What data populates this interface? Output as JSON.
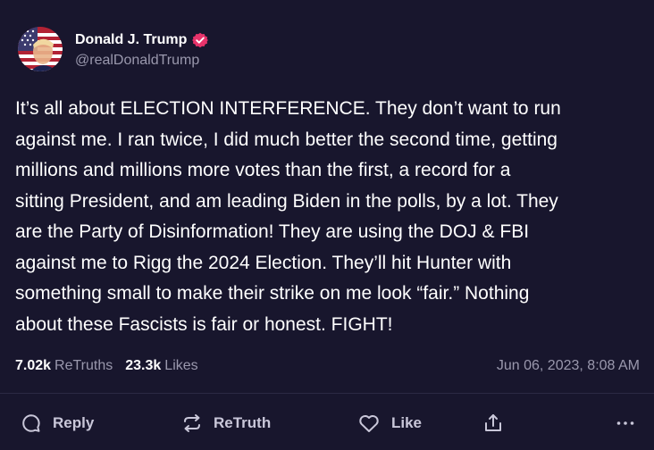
{
  "author": {
    "display_name": "Donald J. Trump",
    "handle": "@realDonaldTrump",
    "verified_icon": "verified-badge-icon",
    "badge_color": "#e8336b"
  },
  "post": {
    "text": "It’s all about ELECTION INTERFERENCE. They don’t want to run\nagainst me. I ran twice, I did much better the second time, getting\nmillions and millions more votes than the first, a record for a\nsitting President, and am leading Biden in the polls, by a lot. They\nare the Party of Disinformation! They are using the DOJ & FBI\nagainst me to Rigg the 2024 Election. They’ll hit Hunter with\nsomething small to make their strike on me look “fair.” Nothing\nabout these Fascists is fair or honest. FIGHT!"
  },
  "stats": {
    "retruths_count": "7.02k",
    "retruths_label": "ReTruths",
    "likes_count": "23.3k",
    "likes_label": "Likes",
    "timestamp": "Jun 06, 2023, 8:08 AM"
  },
  "actions": {
    "reply_label": "Reply",
    "retruth_label": "ReTruth",
    "like_label": "Like",
    "icons": [
      "comment-icon",
      "retruth-icon",
      "heart-icon",
      "share-icon",
      "more-icon"
    ]
  },
  "colors": {
    "background": "#18162d",
    "text": "#ffffff",
    "muted": "#9a98ad",
    "action": "#c9c7d9"
  }
}
